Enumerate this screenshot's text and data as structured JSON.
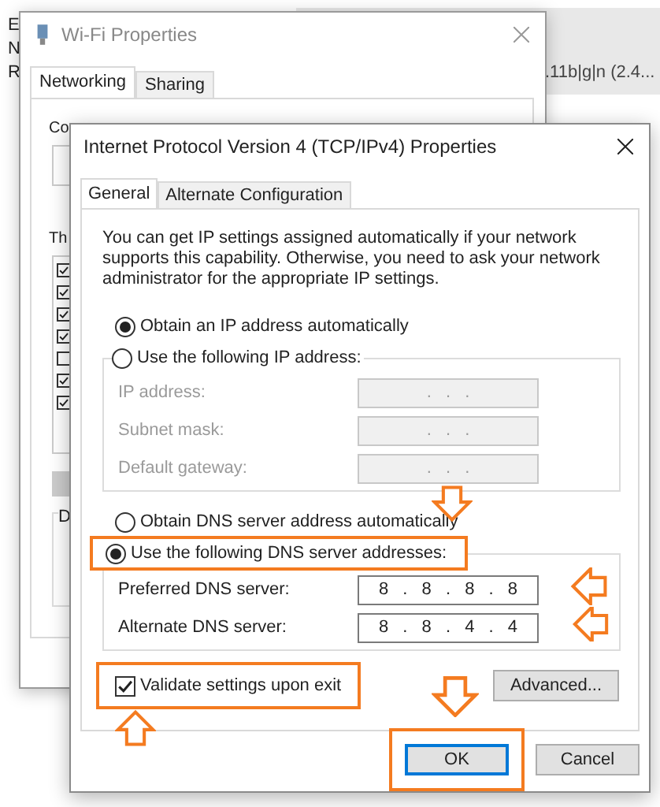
{
  "background_window": {
    "labels": [
      "E",
      "N",
      "R"
    ],
    "adapter_text": ".11b|g|n (2.4..."
  },
  "wifi_window": {
    "title": "Wi-Fi Properties",
    "tabs": [
      {
        "label": "Networking",
        "selected": true
      },
      {
        "label": "Sharing",
        "selected": false
      }
    ],
    "connect_label": "Co",
    "items_label": "Th",
    "items": [
      {
        "checked": true
      },
      {
        "checked": true
      },
      {
        "checked": true
      },
      {
        "checked": true
      },
      {
        "checked": false
      },
      {
        "checked": true
      },
      {
        "checked": true
      }
    ],
    "group_label": "D"
  },
  "dialog": {
    "title": "Internet Protocol Version 4 (TCP/IPv4) Properties",
    "tabs": [
      {
        "label": "General",
        "selected": true
      },
      {
        "label": "Alternate Configuration",
        "selected": false
      }
    ],
    "description": "You can get IP settings assigned automatically if your network supports this capability. Otherwise, you need to ask your network administrator for the appropriate IP settings.",
    "ip_options": [
      {
        "label": "Obtain an IP address automatically",
        "selected": true
      },
      {
        "label": "Use the following IP address:",
        "selected": false
      }
    ],
    "ip_fields": [
      {
        "label": "IP address:",
        "value": ". . .",
        "disabled": true
      },
      {
        "label": "Subnet mask:",
        "value": ". . .",
        "disabled": true
      },
      {
        "label": "Default gateway:",
        "value": ". . .",
        "disabled": true
      }
    ],
    "dns_options": [
      {
        "label": "Obtain DNS server address automatically",
        "selected": false
      },
      {
        "label": "Use the following DNS server addresses:",
        "selected": true
      }
    ],
    "dns_fields": [
      {
        "label": "Preferred DNS server:",
        "value": "8 . 8 . 8 . 8",
        "disabled": false
      },
      {
        "label": "Alternate DNS server:",
        "value": "8 . 8 . 4 . 4",
        "disabled": false
      }
    ],
    "validate": {
      "label": "Validate settings upon exit",
      "checked": true
    },
    "advanced_button": "Advanced...",
    "footer_buttons": [
      {
        "label": "OK",
        "default": true
      },
      {
        "label": "Cancel",
        "default": false
      }
    ]
  }
}
